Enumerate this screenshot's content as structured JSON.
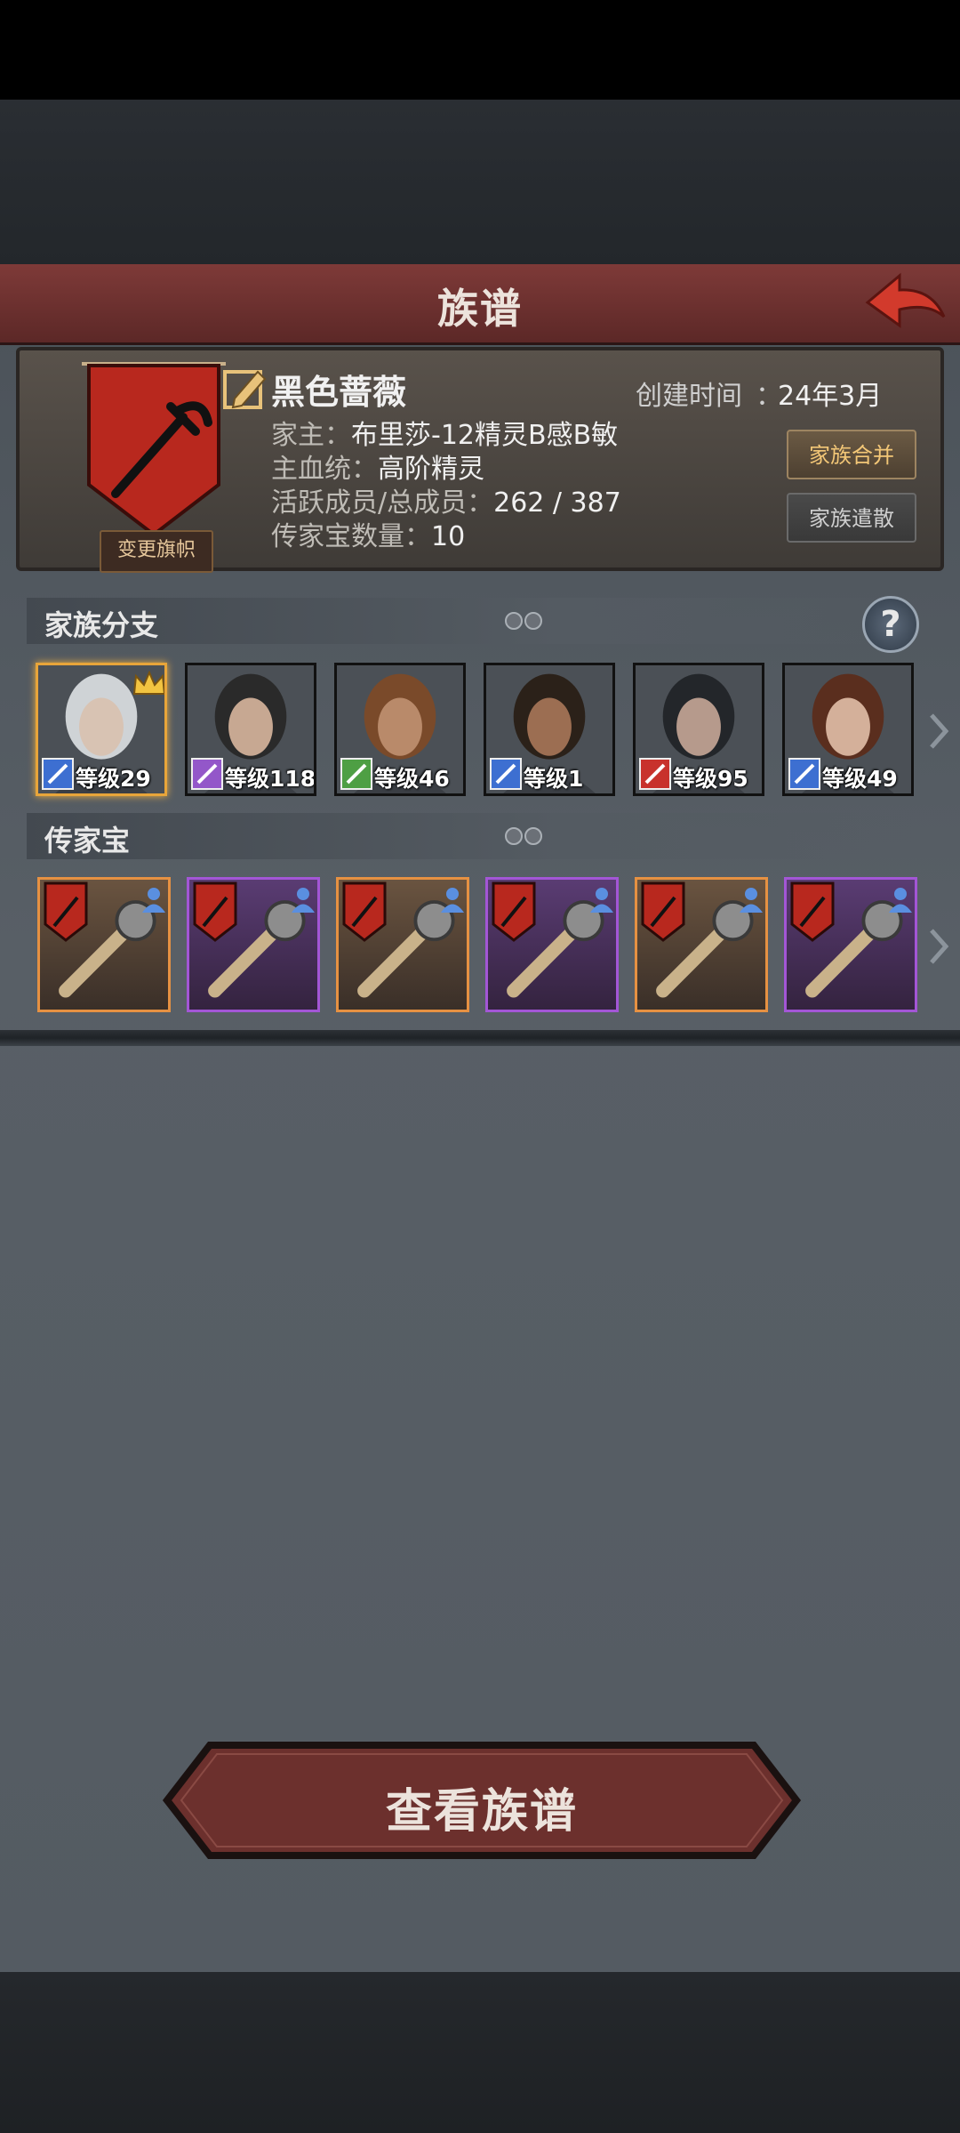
{
  "title": "族谱",
  "family": {
    "name": "黑色蔷薇",
    "change_flag_label": "变更旗帜",
    "created_label": "创建时间",
    "created_sep": "：",
    "created_value": "24年3月",
    "head_label": "家主：",
    "head_value": "布里莎-12精灵B感B敏",
    "bloodline_label": "主血统：",
    "bloodline_value": "高阶精灵",
    "members_label": "活跃成员/总成员：",
    "members_value": "262 / 387",
    "heirloom_label": "传家宝数量：",
    "heirloom_value": "10",
    "merge_button": "家族合并",
    "disband_button": "家族遣散"
  },
  "branches": {
    "section_title": "家族分支",
    "members": [
      {
        "level": "等级29",
        "class_icon": "sword-icon",
        "class_color": "#3d6fd1",
        "selected": true
      },
      {
        "level": "等级118",
        "class_icon": "staff-star-icon",
        "class_color": "#9357c9",
        "selected": false
      },
      {
        "level": "等级46",
        "class_icon": "crossed-arrows-icon",
        "class_color": "#4e9f44",
        "selected": false
      },
      {
        "level": "等级1",
        "class_icon": "sword-icon",
        "class_color": "#3d6fd1",
        "selected": false
      },
      {
        "level": "等级95",
        "class_icon": "beast-icon",
        "class_color": "#c8322c",
        "selected": false
      },
      {
        "level": "等级49",
        "class_icon": "sword-icon",
        "class_color": "#3d6fd1",
        "selected": false
      }
    ]
  },
  "heirlooms": {
    "section_title": "传家宝",
    "items": [
      {
        "name_icon": "ornate-staff-icon",
        "rarity": "orange"
      },
      {
        "name_icon": "fur-coat-icon",
        "rarity": "purple"
      },
      {
        "name_icon": "golden-dagger-icon",
        "rarity": "orange"
      },
      {
        "name_icon": "tower-shield-icon",
        "rarity": "purple"
      },
      {
        "name_icon": "plate-armor-icon",
        "rarity": "orange"
      },
      {
        "name_icon": "warhammer-icon",
        "rarity": "purple"
      }
    ]
  },
  "view_button": "查看族谱",
  "colors": {
    "title_bar": "#6e3231",
    "accent_orange": "#e69142",
    "accent_purple": "#a356d6",
    "banner_red": "#b8281e"
  }
}
